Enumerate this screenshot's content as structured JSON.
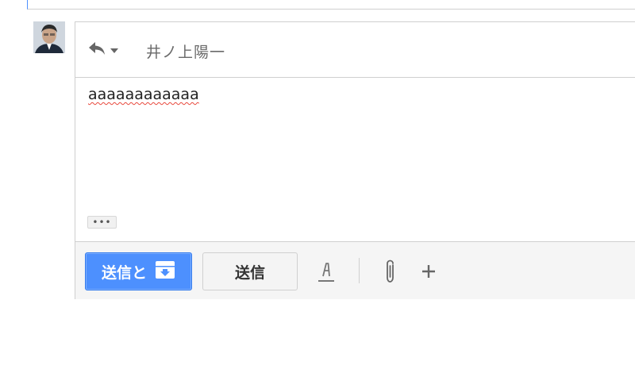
{
  "thread": {
    "recipient": "井ノ上陽一"
  },
  "compose": {
    "body_text": "aaaaaaaaaaaa",
    "trim_label": "•••"
  },
  "toolbar": {
    "send_archive_label": "送信と",
    "send_label": "送信"
  },
  "icons": {
    "reply": "reply-icon",
    "dropdown": "chevron-down-icon",
    "archive": "archive-icon",
    "format": "text-format-icon",
    "attach": "paperclip-icon",
    "more": "plus-icon"
  },
  "colors": {
    "primary": "#4d90fe",
    "spellcheck": "#e8483c",
    "toolbar_bg": "#f5f5f5"
  }
}
